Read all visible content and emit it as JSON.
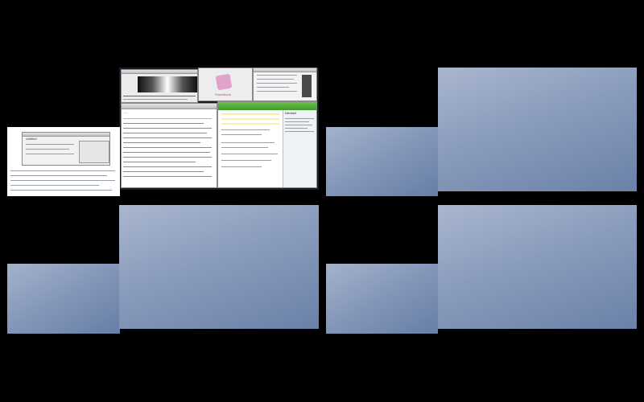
{
  "screen": {
    "background": "#000000",
    "empty_space_color": "#8a9cbc"
  },
  "spaces": [
    {
      "id": 1,
      "state": "occupied"
    },
    {
      "id": 2,
      "state": "empty"
    },
    {
      "id": 3,
      "state": "empty"
    },
    {
      "id": 4,
      "state": "empty"
    }
  ],
  "thumbs": {
    "flash_app_label": "FlashMode",
    "dialog_title": "Untitled",
    "side_panel_title": "Unread"
  }
}
